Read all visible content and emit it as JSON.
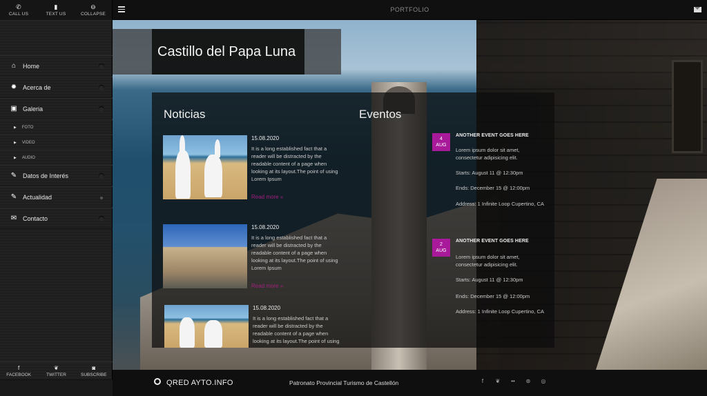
{
  "sidebar": {
    "top_buttons": [
      {
        "label": "CALL US",
        "icon": "phone-icon",
        "glyph": "✆"
      },
      {
        "label": "TEXT US",
        "icon": "chat-icon",
        "glyph": "▮"
      },
      {
        "label": "COLLAPSE",
        "icon": "collapse-icon",
        "glyph": "⊖"
      }
    ],
    "nav": [
      {
        "label": "Home",
        "icon": "home-icon",
        "glyph": "⌂"
      },
      {
        "label": "Acerca de",
        "icon": "gear-icon",
        "glyph": "✹"
      },
      {
        "label": "Galeria",
        "icon": "image-icon",
        "glyph": "▣"
      },
      {
        "label": "FOTO"
      },
      {
        "label": "VIDEO"
      },
      {
        "label": "AUDIO"
      },
      {
        "label": "Datos de Interés",
        "icon": "pencil-icon",
        "glyph": "✎"
      },
      {
        "label": "Actualidad",
        "icon": "pencil-icon",
        "glyph": "✎"
      },
      {
        "label": "Contacto",
        "icon": "envelope-icon",
        "glyph": "✉"
      }
    ],
    "bottom_buttons": [
      {
        "label": "FACEBOOK",
        "icon": "facebook-icon",
        "glyph": "f"
      },
      {
        "label": "TWITTER",
        "icon": "twitter-icon",
        "glyph": "❦"
      },
      {
        "label": "SUBSCRIBE",
        "icon": "rss-icon",
        "glyph": "◙"
      }
    ]
  },
  "topbar": {
    "title": "PORTFOLIO"
  },
  "page": {
    "title": "Castillo del Papa Luna"
  },
  "news": {
    "heading": "Noticias",
    "items": [
      {
        "date": "15.08.2020",
        "text": "It is a long established fact that a reader will be distracted by the readable content of a page when looking at its layout.The point of using Lorem Ipsum",
        "more": "Read more »"
      },
      {
        "date": "15.08.2020",
        "text": "It is a long established fact that a reader will be distracted by the readable content of a page when looking at its layout.The point of using Lorem Ipsum",
        "more": "Read more »"
      },
      {
        "date": "15.08.2020",
        "text": "It is a long established fact that a reader will be distracted by the readable content of a page when looking at its layout.The point of using"
      }
    ]
  },
  "events": {
    "heading": "Eventos",
    "items": [
      {
        "day": "4",
        "month": "AUG",
        "title": "ANOTHER EVENT GOES HERE",
        "desc1": "Lorem ipsum dolor sit amet,",
        "desc2": "consectetur adipisicing elit.",
        "starts": "Starts: August 11 @ 12:30pm",
        "ends": "Ends: December 15 @ 12:00pm",
        "address": "Address: 1 Infinite Loop Cupertino, CA"
      },
      {
        "day": "2",
        "month": "AUG",
        "title": "ANOTHER EVENT GOES HERE",
        "desc1": "Lorem ipsum dolor sit amet,",
        "desc2": "consectetur adipisicing elit.",
        "starts": "Starts: August 11 @ 12:30pm",
        "ends": "Ends: December 15 @ 12:00pm",
        "address": "Address: 1 Infinite Loop Cupertino, CA"
      }
    ]
  },
  "footer": {
    "brand": "QRED AYTO.INFO",
    "center": "Patronato Provincial Turismo de Castellón",
    "social": [
      {
        "icon": "facebook-icon",
        "glyph": "f"
      },
      {
        "icon": "twitter-icon",
        "glyph": "❦"
      },
      {
        "icon": "flickr-icon",
        "glyph": "••"
      },
      {
        "icon": "dribbble-icon",
        "glyph": "⊛"
      },
      {
        "icon": "rss-icon",
        "glyph": "◎"
      }
    ]
  },
  "colors": {
    "accent": "#a81a9a",
    "link": "#a0207e",
    "sidebar": "#1e1e1e",
    "panel": "#0c0c0c"
  }
}
